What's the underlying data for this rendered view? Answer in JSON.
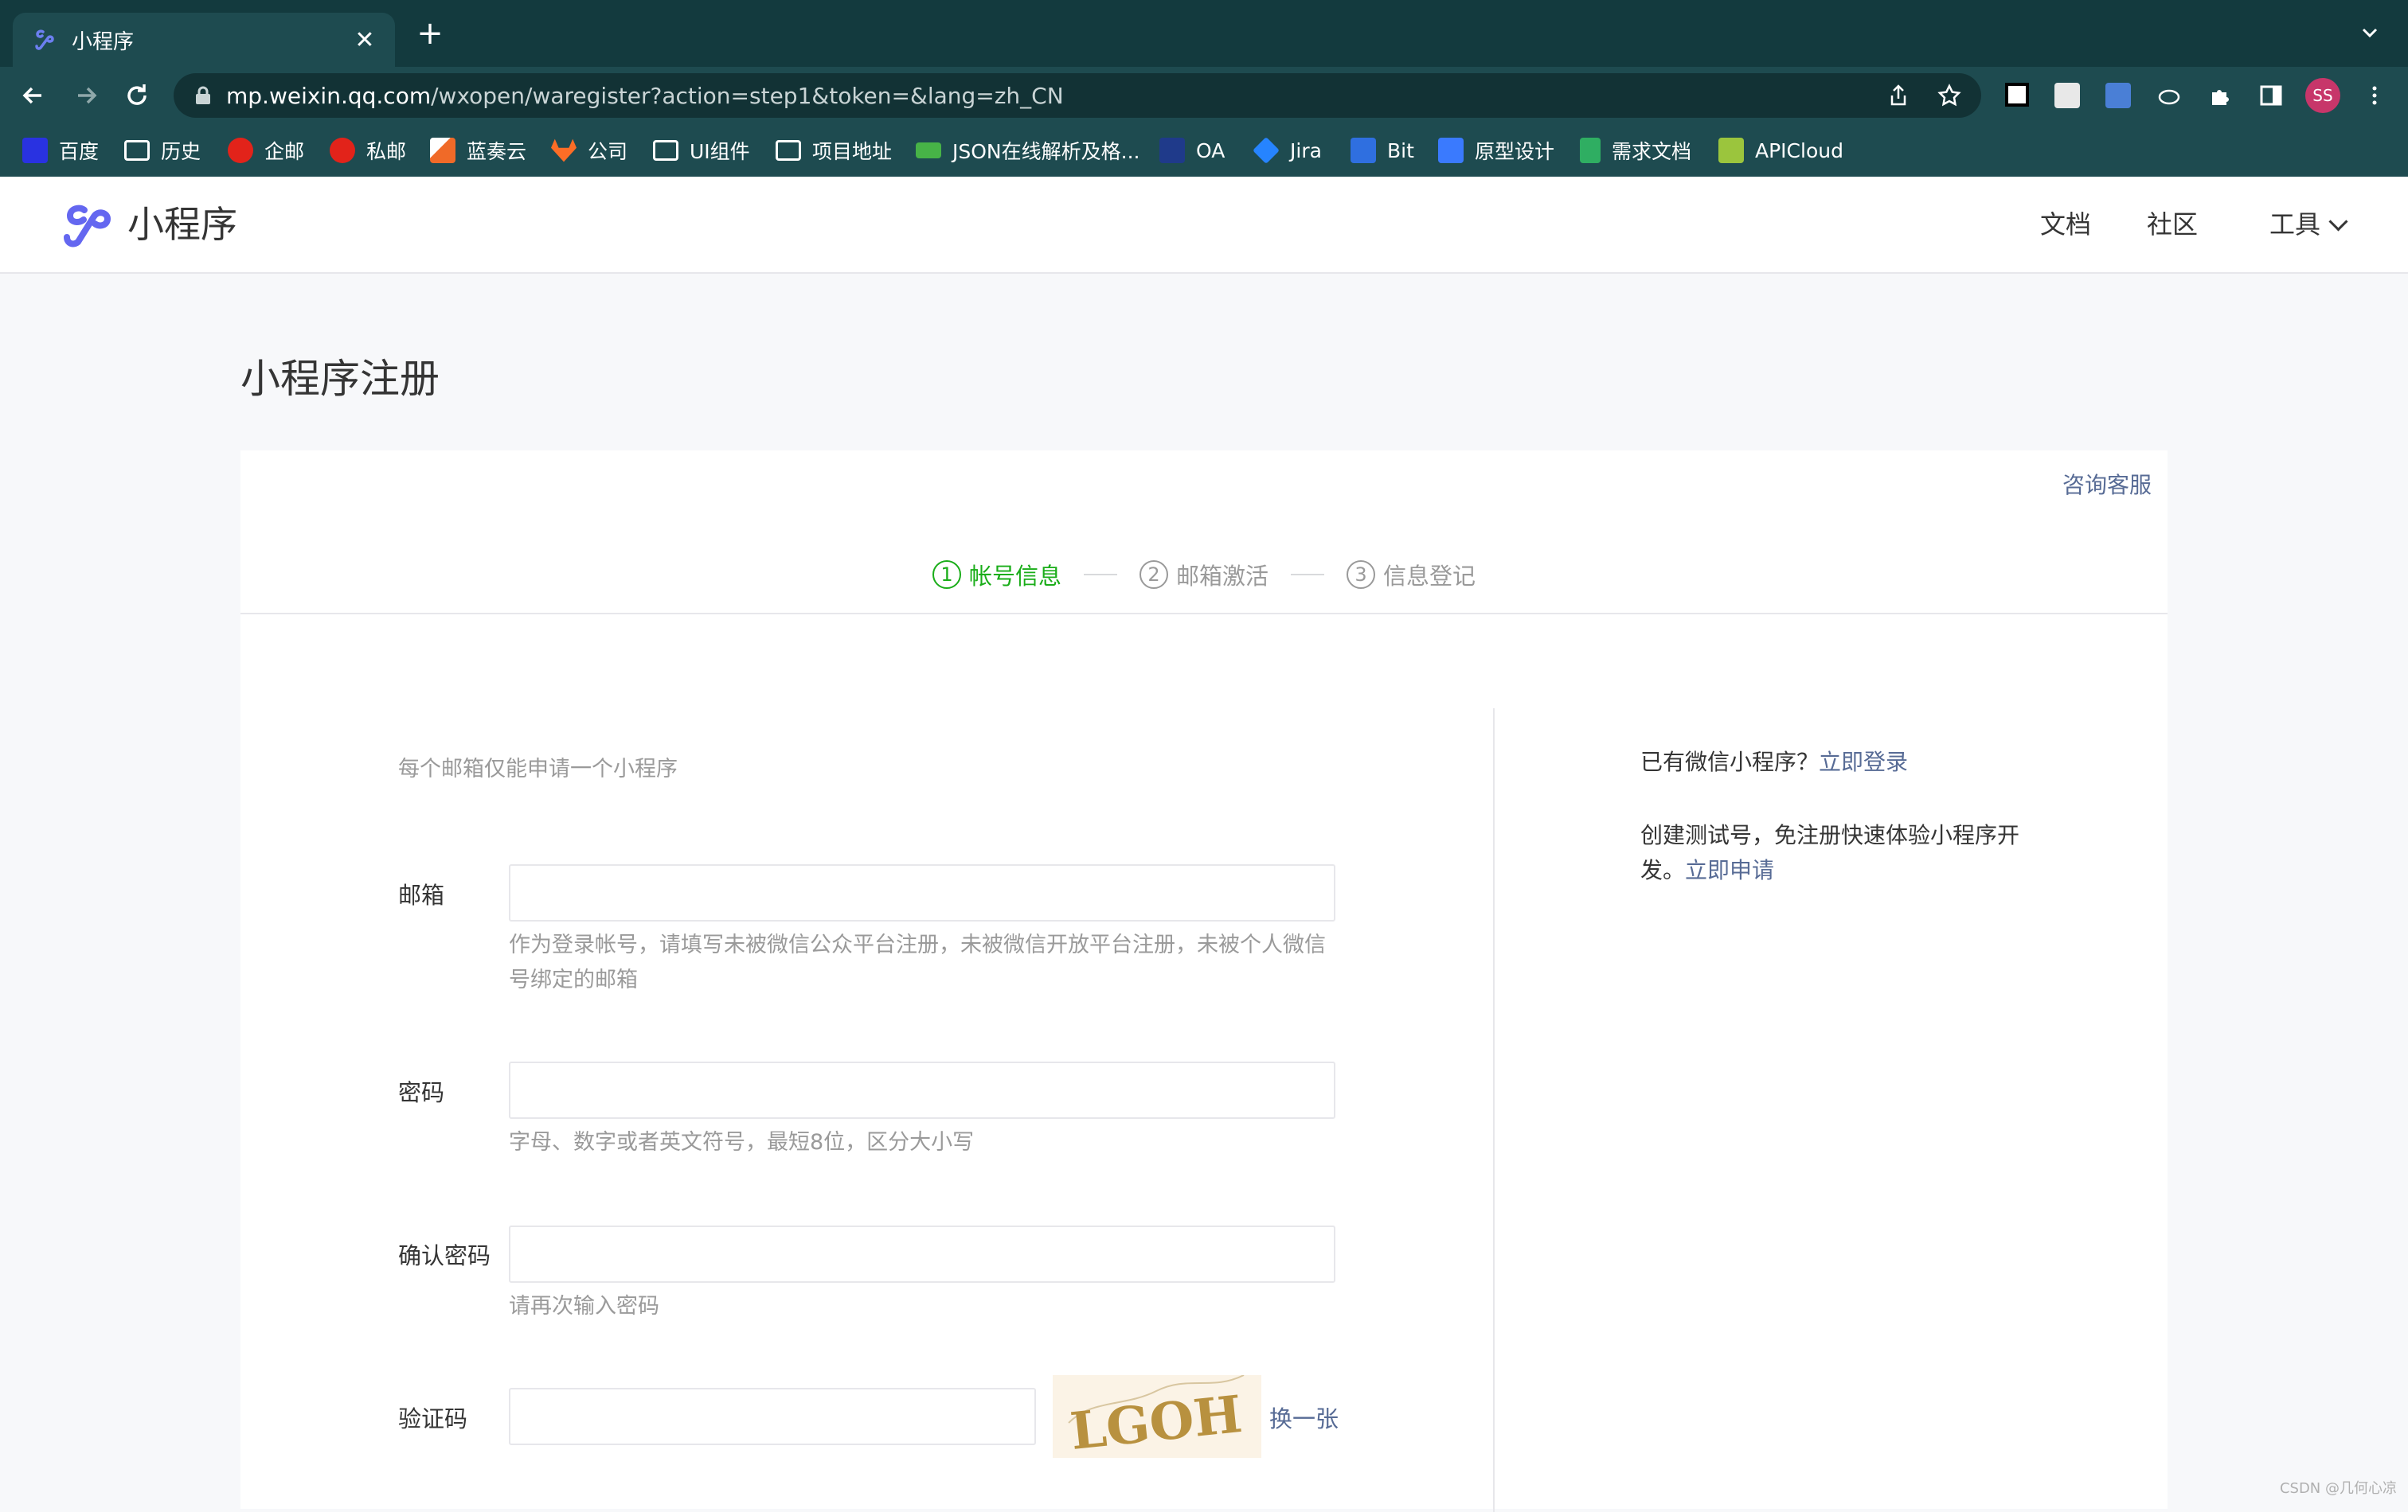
{
  "browser": {
    "tab_title": "小程序",
    "url_host": "mp.weixin.qq.com",
    "url_path": "/wxopen/waregister?action=step1&token=&lang=zh_CN",
    "profile_initials": "SS",
    "bookmarks": [
      {
        "label": "百度",
        "icon": "baidu-icon",
        "color": "#2932e1"
      },
      {
        "label": "历史",
        "icon": "folder-icon",
        "color": "#ffffff"
      },
      {
        "label": "企邮",
        "icon": "tencent-mail-icon",
        "color": "#e2231a"
      },
      {
        "label": "私邮",
        "icon": "tencent-mail-icon",
        "color": "#e2231a"
      },
      {
        "label": "蓝奏云",
        "icon": "lanzou-icon",
        "color": "#f06a28"
      },
      {
        "label": "公司",
        "icon": "gitlab-icon",
        "color": "#fc6d26"
      },
      {
        "label": "UI组件",
        "icon": "folder-icon",
        "color": "#ffffff"
      },
      {
        "label": "项目地址",
        "icon": "folder-icon",
        "color": "#ffffff"
      },
      {
        "label": "JSON在线解析及格...",
        "icon": "json-icon",
        "color": "#47b347"
      },
      {
        "label": "OA",
        "icon": "oa-icon",
        "color": "#1f3a8a"
      },
      {
        "label": "Jira",
        "icon": "jira-icon",
        "color": "#2684ff"
      },
      {
        "label": "Bit",
        "icon": "bit-icon",
        "color": "#2f6fe0"
      },
      {
        "label": "原型设计",
        "icon": "prototype-icon",
        "color": "#3a7afe"
      },
      {
        "label": "需求文档",
        "icon": "doc-icon",
        "color": "#2fae62"
      },
      {
        "label": "APICloud",
        "icon": "apicloud-icon",
        "color": "#9bc53d"
      }
    ]
  },
  "header": {
    "site_name": "小程序",
    "nav": {
      "docs": "文档",
      "community": "社区",
      "tools": "工具"
    }
  },
  "page": {
    "title": "小程序注册",
    "consult": "咨询客服",
    "steps": [
      {
        "num": "1",
        "label": "帐号信息",
        "active": true
      },
      {
        "num": "2",
        "label": "邮箱激活",
        "active": false
      },
      {
        "num": "3",
        "label": "信息登记",
        "active": false
      }
    ],
    "form": {
      "intro": "每个邮箱仅能申请一个小程序",
      "email": {
        "label": "邮箱",
        "value": "",
        "tip": "作为登录帐号，请填写未被微信公众平台注册，未被微信开放平台注册，未被个人微信号绑定的邮箱"
      },
      "password": {
        "label": "密码",
        "value": "",
        "tip": "字母、数字或者英文符号，最短8位，区分大小写"
      },
      "confirm": {
        "label": "确认密码",
        "value": "",
        "tip": "请再次输入密码"
      },
      "captcha": {
        "label": "验证码",
        "value": "",
        "image_text": "LGOH",
        "refresh": "换一张"
      }
    },
    "side": {
      "login_prompt": "已有微信小程序？",
      "login_link": "立即登录",
      "test_prompt": "创建测试号，免注册快速体验小程序开发。",
      "test_link": "立即申请"
    }
  },
  "watermark": "CSDN @几何心凉",
  "colors": {
    "accent": "#1aad19",
    "link": "#576b95",
    "brand": "#6467f0",
    "chrome": "#1e4b50"
  }
}
